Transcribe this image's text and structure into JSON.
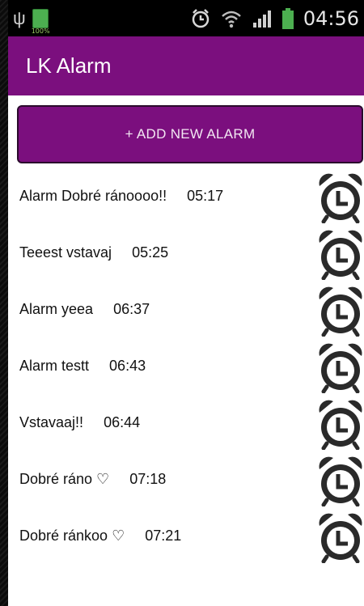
{
  "statusbar": {
    "battery_small_label": "100%",
    "time": "04:56",
    "icons": [
      "usb-icon",
      "battery-icon",
      "alarm-status-icon",
      "wifi-icon",
      "signal-icon",
      "battery-icon"
    ]
  },
  "app": {
    "title": "LK Alarm",
    "accent": "#7b0f7e"
  },
  "add_button": {
    "label": "+ ADD NEW ALARM"
  },
  "alarms": [
    {
      "name": "Alarm Dobré ránoooo!!",
      "time": "05:17"
    },
    {
      "name": "Teeest vstavaj",
      "time": "05:25"
    },
    {
      "name": "Alarm yeea",
      "time": "06:37"
    },
    {
      "name": "Alarm testt",
      "time": "06:43"
    },
    {
      "name": "Vstavaaj!!",
      "time": "06:44"
    },
    {
      "name": "Dobré ráno ♡",
      "time": "07:18"
    },
    {
      "name": "Dobré ránkoo ♡",
      "time": "07:21"
    }
  ]
}
